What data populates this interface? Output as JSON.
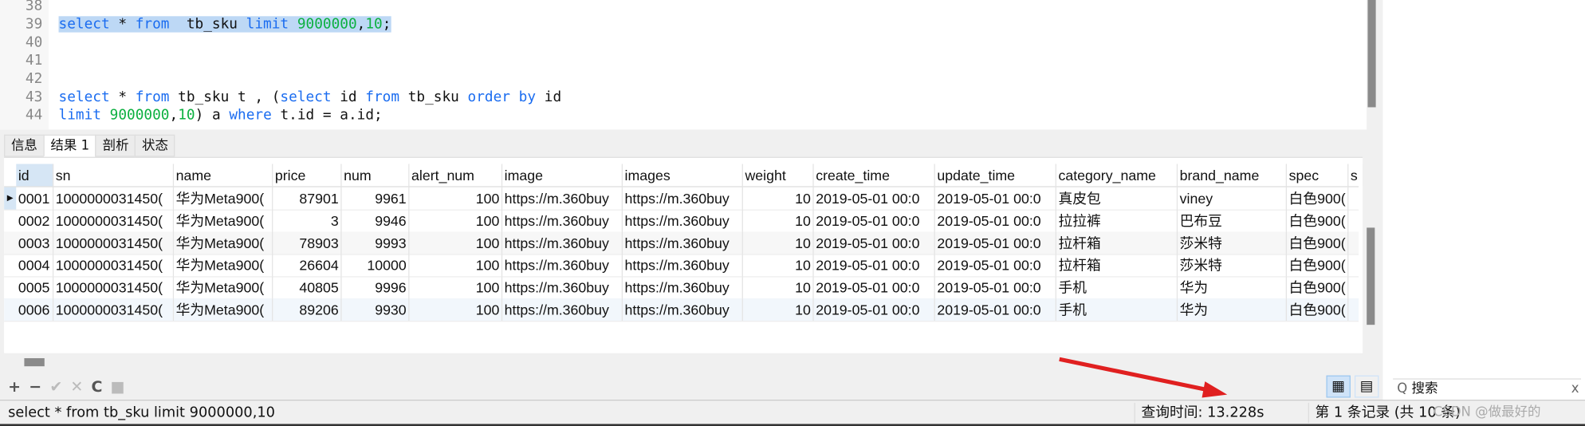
{
  "editor": {
    "lines": [
      {
        "n": "38",
        "parts": []
      },
      {
        "n": "39",
        "parts": [
          [
            "kw",
            "select"
          ],
          [
            "",
            "* "
          ],
          [
            "kw",
            "from"
          ],
          [
            "",
            "  tb_sku "
          ],
          [
            "kw",
            "limit"
          ],
          [
            "",
            " "
          ],
          [
            "nm",
            "9000000"
          ],
          [
            "",
            ","
          ],
          [
            "nm",
            "10"
          ],
          [
            "",
            ";"
          ]
        ],
        "selected": true
      },
      {
        "n": "40",
        "parts": []
      },
      {
        "n": "41",
        "parts": []
      },
      {
        "n": "42",
        "parts": []
      },
      {
        "n": "43",
        "parts": [
          [
            "kw",
            "select"
          ],
          [
            "",
            "",
            " "
          ],
          [
            "",
            "* "
          ],
          [
            "kw",
            "from"
          ],
          [
            "",
            " tb_sku t , ("
          ],
          [
            "kw",
            "select"
          ],
          [
            "",
            " id "
          ],
          [
            "kw",
            "from"
          ],
          [
            "",
            " tb_sku "
          ],
          [
            "kw",
            "order by"
          ],
          [
            "",
            " id"
          ]
        ]
      },
      {
        "n": "44",
        "parts": [
          [
            "kw",
            "limit"
          ],
          [
            "",
            " "
          ],
          [
            "nm",
            "10"
          ],
          [
            "",
            ""
          ]
        ]
      }
    ],
    "line39": {
      "kw1": "select",
      "t1": " * ",
      "kw2": "from",
      "t2": "  tb_sku ",
      "kw3": "limit",
      "t3": " ",
      "n1": "9000000",
      "t4": ",",
      "n2": "10",
      "t5": ";"
    },
    "line43": {
      "kw1": "select",
      "t1": " * ",
      "kw2": "from",
      "t2": " tb_sku t , (",
      "kw3": "select",
      "t3": " id ",
      "kw4": "from",
      "t4": " tb_sku ",
      "kw5": "order by",
      "t5": " id"
    },
    "line44": {
      "kw1": "limit",
      "t1": " ",
      "n1": "9000000",
      "t2": ",",
      "n2": "10",
      "t3": ") a ",
      "kw2": "where",
      "t4": " t.id = a.id;"
    }
  },
  "tabs": [
    "信息",
    "结果 1",
    "剖析",
    "状态"
  ],
  "active_tab": "结果 1",
  "table": {
    "columns": [
      "id",
      "sn",
      "name",
      "price",
      "num",
      "alert_num",
      "image",
      "images",
      "weight",
      "create_time",
      "update_time",
      "category_name",
      "brand_name",
      "spec",
      "s"
    ],
    "rows": [
      [
        "0001",
        "1000000031450(",
        "华为Meta900(",
        "87901",
        "9961",
        "100",
        "https://m.360buy",
        "https://m.360buy",
        "10",
        "2019-05-01 00:0",
        "2019-05-01 00:0",
        "真皮包",
        "viney",
        "白色900("
      ],
      [
        "0002",
        "1000000031450(",
        "华为Meta900(",
        "3",
        "9946",
        "100",
        "https://m.360buy",
        "https://m.360buy",
        "10",
        "2019-05-01 00:0",
        "2019-05-01 00:0",
        "拉拉裤",
        "巴布豆",
        "白色900("
      ],
      [
        "0003",
        "1000000031450(",
        "华为Meta900(",
        "78903",
        "9993",
        "100",
        "https://m.360buy",
        "https://m.360buy",
        "10",
        "2019-05-01 00:0",
        "2019-05-01 00:0",
        "拉杆箱",
        "莎米特",
        "白色900("
      ],
      [
        "0004",
        "1000000031450(",
        "华为Meta900(",
        "26604",
        "10000",
        "100",
        "https://m.360buy",
        "https://m.360buy",
        "10",
        "2019-05-01 00:0",
        "2019-05-01 00:0",
        "拉杆箱",
        "莎米特",
        "白色900("
      ],
      [
        "0005",
        "1000000031450(",
        "华为Meta900(",
        "40805",
        "9996",
        "100",
        "https://m.360buy",
        "https://m.360buy",
        "10",
        "2019-05-01 00:0",
        "2019-05-01 00:0",
        "手机",
        "华为",
        "白色900("
      ],
      [
        "0006",
        "1000000031450(",
        "华为Meta900(",
        "89206",
        "9930",
        "100",
        "https://m.360buy",
        "https://m.360buy",
        "10",
        "2019-05-01 00:0",
        "2019-05-01 00:0",
        "手机",
        "华为",
        "白色900("
      ]
    ]
  },
  "toolbar": {
    "add": "+",
    "remove": "−",
    "apply": "✔",
    "cancel": "✕",
    "refresh": "C",
    "stop": "■"
  },
  "search": {
    "icon": "Q",
    "placeholder": "搜索",
    "clear": "x"
  },
  "status": {
    "sql": "select * from  tb_sku limit 9000000,10",
    "query_time": "查询时间: 13.228s",
    "records": "第 1 条记录 (共 10 条)",
    "watermark": "CSDN @做最好的"
  },
  "colors": {
    "keyword": "#1a6cf0",
    "number": "#0cb040",
    "selection": "#bdd8f5",
    "arrow": "#e02020"
  }
}
